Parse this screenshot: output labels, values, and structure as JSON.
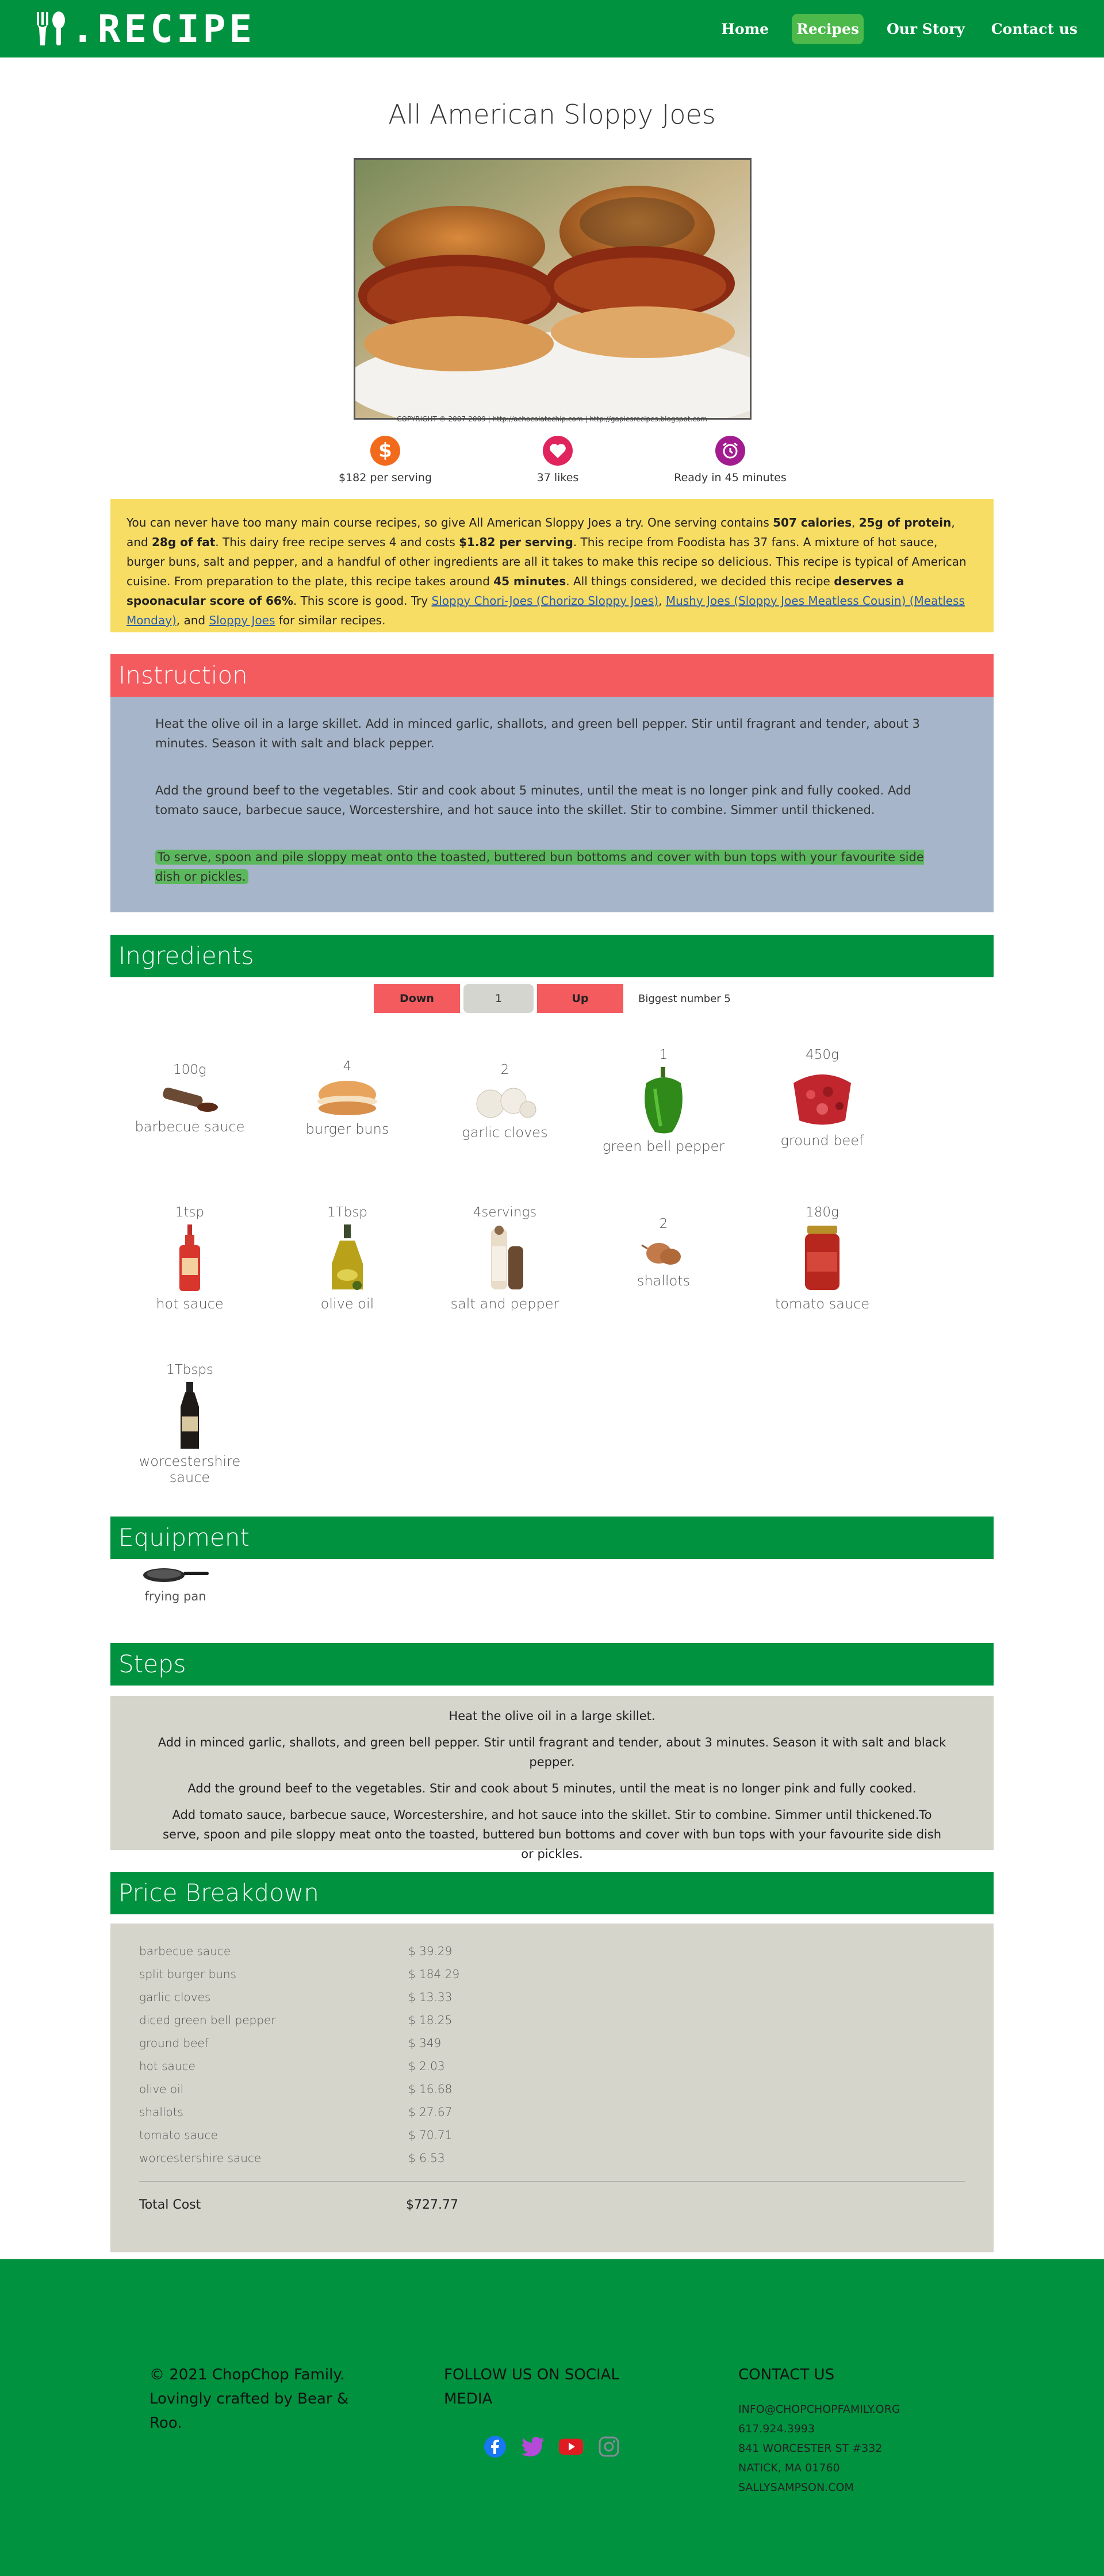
{
  "nav": {
    "brand": ".RECIPE",
    "links": [
      "Home",
      "Recipes",
      "Our Story",
      "Contact us"
    ],
    "active_index": 1
  },
  "recipe": {
    "title": "All American Sloppy Joes",
    "image_caption": "COPYRIGHT © 2007-2009 | http://achocolatechip.com | http://gapiesrecipes.blogspot.com",
    "stats": {
      "price": "$182 per serving",
      "likes": "37 likes",
      "ready": "Ready in 45 minutes"
    }
  },
  "summary": {
    "p1": "You can never have too many main course recipes, so give All American Sloppy Joes a try. One serving contains ",
    "calories": "507 calories",
    "sep1": ", ",
    "protein": "25g of protein",
    "sep2": ", and ",
    "fat": "28g of fat",
    "p2": ". This dairy free recipe serves 4 and costs ",
    "cost": "$1.82 per serving",
    "p3": ". This recipe from Foodista has 37 fans. A mixture of hot sauce, burger buns, salt and pepper, and a handful of other ingredients are all it takes to make this recipe so delicious. This recipe is typical of American cuisine. From preparation to the plate, this recipe takes around ",
    "time": "45 minutes",
    "p4": ". All things considered, we decided this recipe ",
    "score": "deserves a spoonacular score of 66%",
    "p5": ". This score is good. Try ",
    "link1": "Sloppy Chori-Joes (Chorizo Sloppy Joes)",
    "sep3": ", ",
    "link2": "Mushy Joes (Sloppy Joes Meatless Cousin) (Meatless Monday)",
    "sep4": ", and ",
    "link3": "Sloppy Joes",
    "p6": " for similar recipes."
  },
  "instruction": {
    "heading": "Instruction",
    "paragraphs": [
      "Heat the olive oil in a large skillet. Add in minced garlic, shallots, and green bell pepper. Stir until fragrant and tender, about 3 minutes. Season it with salt and black pepper.",
      "Add the ground beef to the vegetables. Stir and cook about 5 minutes, until the meat is no longer pink and fully cooked. Add tomato sauce, barbecue sauce, Worcestershire, and hot sauce into the skillet. Stir to combine. Simmer until thickened.",
      "To serve, spoon and pile sloppy meat onto the toasted, buttered bun bottoms and cover with bun tops with your favourite side dish or pickles."
    ]
  },
  "ingredients": {
    "heading": "Ingredients",
    "down_label": "Down",
    "count": "1",
    "up_label": "Up",
    "biggest": "Biggest number 5",
    "items": [
      {
        "amount": "100g",
        "name": "barbecue sauce"
      },
      {
        "amount": "4",
        "name": "burger buns"
      },
      {
        "amount": "2",
        "name": "garlic cloves"
      },
      {
        "amount": "1",
        "name": "green bell pepper"
      },
      {
        "amount": "450g",
        "name": "ground beef"
      },
      {
        "amount": "1tsp",
        "name": "hot sauce"
      },
      {
        "amount": "1Tbsp",
        "name": "olive oil"
      },
      {
        "amount": "4servings",
        "name": "salt and pepper"
      },
      {
        "amount": "2",
        "name": "shallots"
      },
      {
        "amount": "180g",
        "name": "tomato sauce"
      },
      {
        "amount": "1Tbsps",
        "name": "worcestershire sauce"
      }
    ]
  },
  "equipment": {
    "heading": "Equipment",
    "items": [
      {
        "name": "frying pan"
      }
    ]
  },
  "steps": {
    "heading": "Steps",
    "items": [
      "Heat the olive oil in a large skillet.",
      "Add in minced garlic, shallots, and green bell pepper. Stir until fragrant and tender, about 3 minutes. Season it with salt and black pepper.",
      "Add the ground beef to the vegetables. Stir and cook about 5 minutes, until the meat is no longer pink and fully cooked.",
      "Add tomato sauce, barbecue sauce, Worcestershire, and hot sauce into the skillet. Stir to combine. Simmer until thickened.To serve, spoon and pile sloppy meat onto the toasted, buttered bun bottoms and cover with bun tops with your favourite side dish or pickles."
    ]
  },
  "price": {
    "heading": "Price Breakdown",
    "rows": [
      {
        "name": "barbecue sauce",
        "cost": "$ 39.29"
      },
      {
        "name": "split burger buns",
        "cost": "$ 184.29"
      },
      {
        "name": "garlic cloves",
        "cost": "$ 13.33"
      },
      {
        "name": "diced green bell pepper",
        "cost": "$ 18.25"
      },
      {
        "name": "ground beef",
        "cost": "$ 349"
      },
      {
        "name": "hot sauce",
        "cost": "$ 2.03"
      },
      {
        "name": "olive oil",
        "cost": "$ 16.68"
      },
      {
        "name": "shallots",
        "cost": "$ 27.67"
      },
      {
        "name": "tomato sauce",
        "cost": "$ 70.71"
      },
      {
        "name": "worcestershire sauce",
        "cost": "$ 6.53"
      }
    ],
    "total_label": "Total Cost",
    "total_value": "$727.77"
  },
  "footer": {
    "copyright": "© 2021 ChopChop Family. Lovingly crafted by Bear & Roo.",
    "social_heading": "FOLLOW US ON SOCIAL MEDIA",
    "social_icons": [
      "facebook-icon",
      "twitter-icon",
      "youtube-icon",
      "instagram-icon"
    ],
    "contact_heading": "CONTACT US",
    "contact_lines": [
      "INFO@CHOPCHOPFAMILY.ORG",
      "617.924.3993",
      "841 WORCESTER ST #332",
      "NATICK, MA 01760",
      "SALLYSAMPSON.COM"
    ]
  },
  "colors": {
    "brand_green": "#00923f",
    "accent_red": "#f45b5f",
    "summary_yellow": "#f8dd65",
    "instruction_blue": "#a6b5c9",
    "panel_gray": "#d5d5cc"
  }
}
